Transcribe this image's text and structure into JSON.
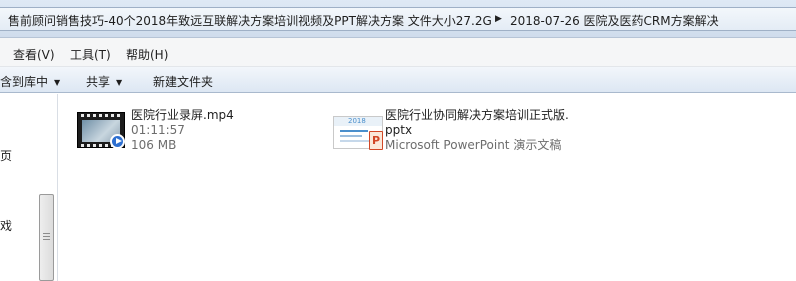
{
  "address_bar": {
    "crumbs": [
      "售前顾问销售技巧-40个2018年致远互联解决方案培训视频及PPT解决方案 文件大小27.2G",
      "2018-07-26 医院及医药CRM方案解决"
    ]
  },
  "menu": {
    "items": [
      "查看(V)",
      "工具(T)",
      "帮助(H)"
    ]
  },
  "toolbar": {
    "add_to_library": "含到库中",
    "share": "共享",
    "new_folder": "新建文件夹"
  },
  "nav_pane": {
    "labels": [
      "页",
      "戏"
    ]
  },
  "files": [
    {
      "name": "医院行业录屏.mp4",
      "duration": "01:11:57",
      "size": "106 MB",
      "icon": "video-thumbnail-icon"
    },
    {
      "name_line1": "医院行业协同解决方案培训正式版.",
      "name_line2": "pptx",
      "type": "Microsoft PowerPoint 演示文稿",
      "thumb_label": "2018",
      "badge": "P",
      "icon": "powerpoint-icon"
    }
  ]
}
